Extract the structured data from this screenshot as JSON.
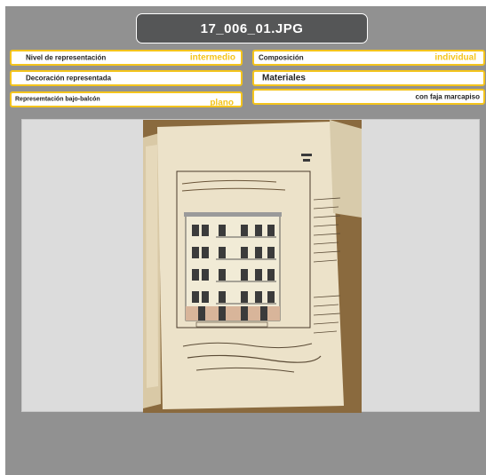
{
  "title": "17_006_01.JPG",
  "fields": {
    "nivel": {
      "label": "Nivel de representación",
      "value": "intermedio"
    },
    "composicion": {
      "label": "Composición",
      "value": "individual"
    },
    "decoracion": {
      "label": "Decoración representada",
      "value": ""
    },
    "materiales": {
      "label": "Materiales",
      "value": ""
    },
    "bajo_balcon": {
      "label": "Represemtación bajo-balcón",
      "value": "plano"
    },
    "extra": {
      "label": "",
      "value": "con faja marcapiso"
    }
  },
  "colors": {
    "panel": "#919191",
    "title_bg": "#555657",
    "accent": "#f4c41c"
  },
  "image": {
    "description_icon": "architectural-drawing-photo"
  }
}
